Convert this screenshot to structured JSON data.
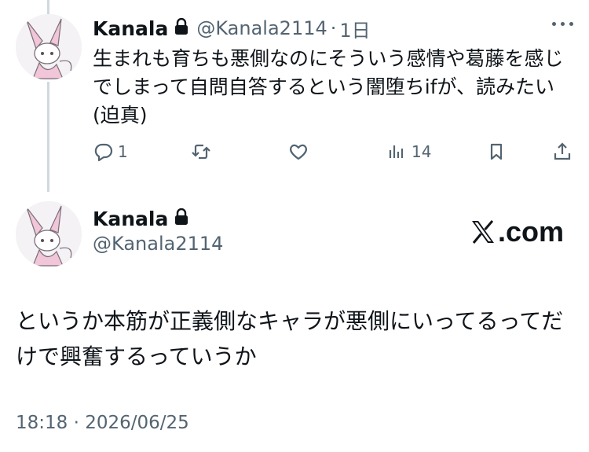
{
  "reply": {
    "name": "Kanala",
    "handle": "@Kanala2114",
    "separator": "·",
    "time": "1日",
    "text": "生まれも育ちも悪側なのにそういう感情や葛藤を感じでしまって自問自答するという闇堕ちifが、読みたい(迫真)",
    "actions": {
      "reply_count": "1",
      "retweet_count": "",
      "like_count": "",
      "views_count": "14"
    }
  },
  "main": {
    "name": "Kanala",
    "handle": "@Kanala2114",
    "brand": ".com",
    "text": "というか本筋が正義側なキャラが悪側にいってるってだけで興奮するっていうか",
    "timestamp": "18:18 · 2026/06/25"
  },
  "icons": [
    "lock-icon",
    "more-icon",
    "reply-icon",
    "retweet-icon",
    "like-icon",
    "views-icon",
    "bookmark-icon",
    "share-icon",
    "x-logo-icon"
  ],
  "colors": {
    "text": "#0f1419",
    "secondary": "#536471",
    "thread_line": "#cfd9de",
    "avatar_accent": "#e8a8c4"
  }
}
